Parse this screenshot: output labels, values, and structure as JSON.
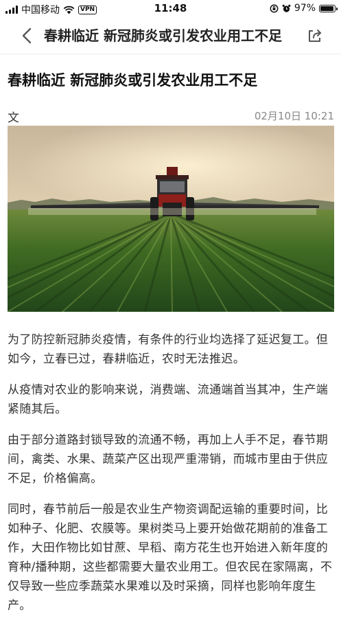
{
  "status_bar": {
    "carrier": "中国移动",
    "vpn": "VPN",
    "time": "11:48",
    "battery": "97%",
    "battery_level": 0.97
  },
  "nav": {
    "title": "春耕临近 新冠肺炎或引发农业用工不足"
  },
  "article": {
    "title": "春耕临近 新冠肺炎或引发农业用工不足",
    "author": "文",
    "date": "02月10日 10:21",
    "paragraphs": [
      "为了防控新冠肺炎疫情，有条件的行业均选择了延迟复工。但如今，立春已过，春耕临近，农时无法推迟。",
      "从疫情对农业的影响来说，消费端、流通端首当其冲，生产端紧随其后。",
      "由于部分道路封锁导致的流通不畅，再加上人手不足，春节期间，禽类、水果、蔬菜产区出现严重滞销，而城市里由于供应不足，价格偏高。",
      "同时，春节前后一般是农业生产物资调配运输的重要时间，比如种子、化肥、农膜等。果树类马上要开始做花期前的准备工作，大田作物比如甘蔗、早稻、南方花生也开始进入新年度的育种/播种期，这些都需要大量农业用工。但农民在家隔离，不仅导致一些应季蔬菜水果难以及时采摘，同样也影响年度生产。"
    ]
  },
  "colors": {
    "text_primary": "#222222",
    "text_secondary": "#888888",
    "divider": "#ececec"
  }
}
